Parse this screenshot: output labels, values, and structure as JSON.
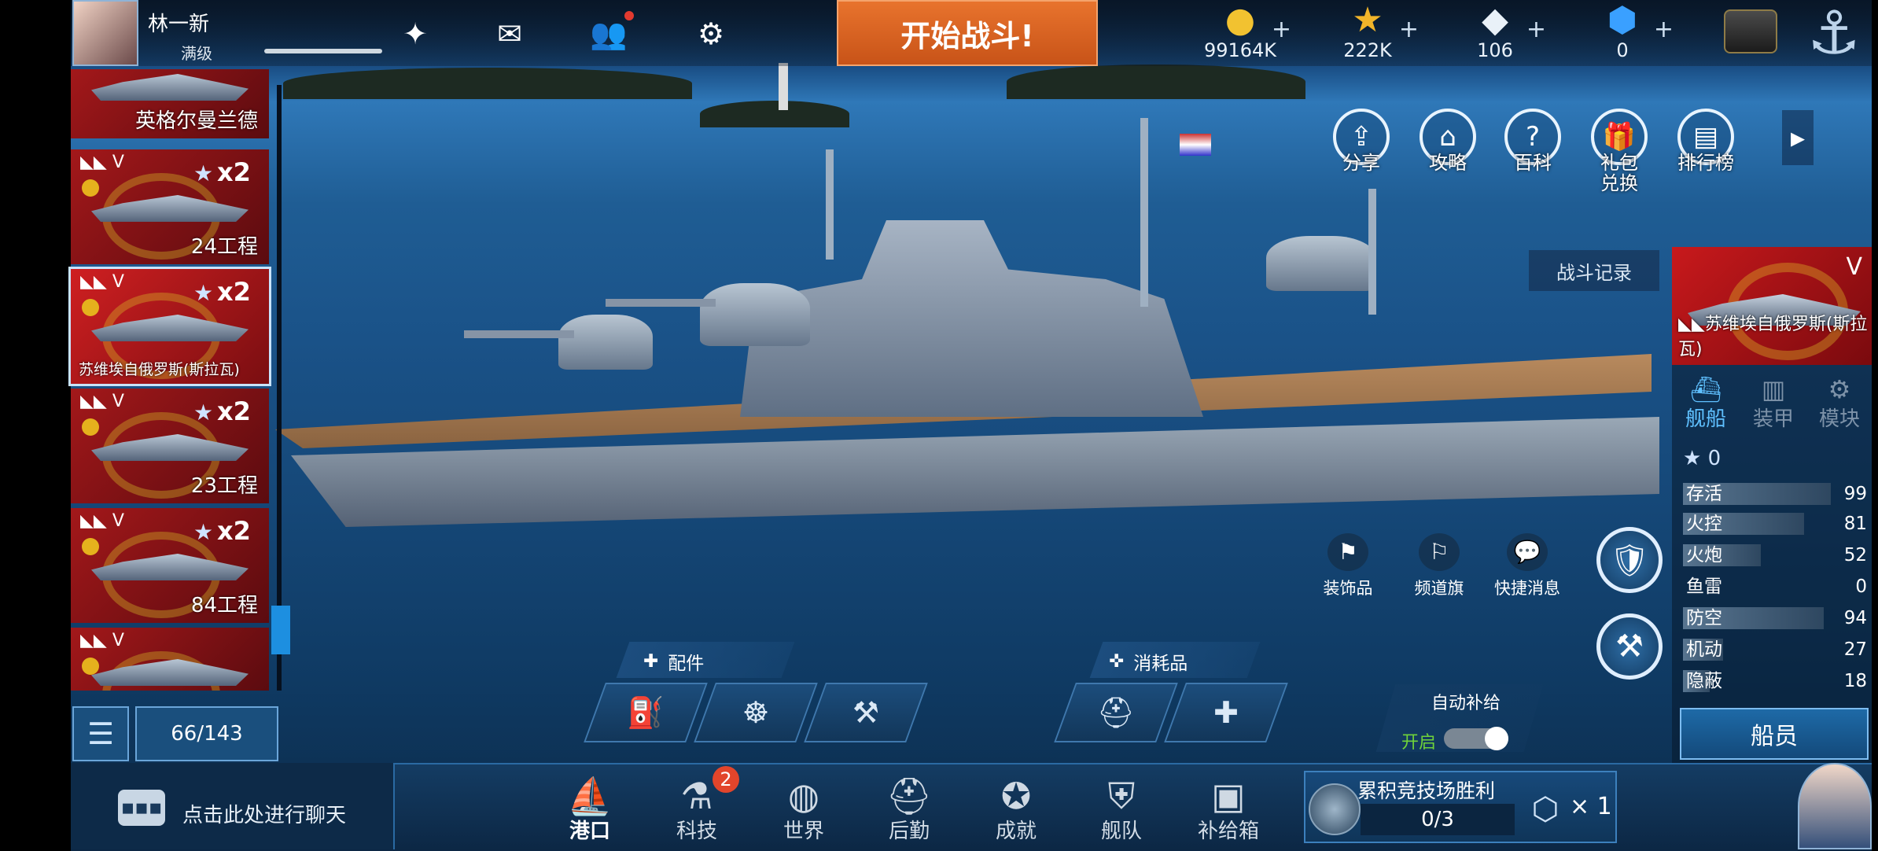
{
  "player": {
    "name": "林一新",
    "level": "满级"
  },
  "top_icons": [
    {
      "name": "wings-icon",
      "glyph": "✦"
    },
    {
      "name": "mail-icon",
      "glyph": "✉"
    },
    {
      "name": "friends-icon",
      "glyph": "👥"
    },
    {
      "name": "gear-icon",
      "glyph": "⚙"
    }
  ],
  "start_battle": "开始战斗!",
  "resources": [
    {
      "name": "gold",
      "icon": "●",
      "value": "99164K",
      "color": "#f2c230"
    },
    {
      "name": "merit",
      "icon": "★",
      "value": "222K",
      "color": "#f2b52a"
    },
    {
      "name": "diamond",
      "icon": "◆",
      "value": "106",
      "color": "#e9f1f8"
    },
    {
      "name": "cube",
      "icon": "⬢",
      "value": "0",
      "color": "#3aa0ff"
    }
  ],
  "features": [
    {
      "label": "分享",
      "glyph": "⇪"
    },
    {
      "label": "攻略",
      "glyph": "⌂"
    },
    {
      "label": "百科",
      "glyph": "?"
    },
    {
      "label": "礼包兑换",
      "glyph": "🎁"
    },
    {
      "label": "排行榜",
      "glyph": "▤"
    }
  ],
  "battle_record": "战斗记录",
  "ship_list": {
    "items": [
      {
        "tier": "",
        "mult": "",
        "name": "英格尔曼兰德",
        "selected": false
      },
      {
        "tier": "V",
        "mult": "x2",
        "name": "24工程",
        "selected": false
      },
      {
        "tier": "V",
        "mult": "x2",
        "name": "苏维埃自俄罗斯(斯拉瓦)",
        "selected": true
      },
      {
        "tier": "V",
        "mult": "x2",
        "name": "23工程",
        "selected": false
      },
      {
        "tier": "V",
        "mult": "x2",
        "name": "84工程",
        "selected": false
      },
      {
        "tier": "V",
        "mult": "",
        "name": "",
        "selected": false
      }
    ],
    "count": "66/143"
  },
  "ship_panel": {
    "tier": "V",
    "name": "苏维埃自俄罗斯(斯拉瓦)",
    "tabs": [
      "舰船",
      "装甲",
      "模块"
    ],
    "stars": "0",
    "stats": [
      {
        "label": "存活",
        "value": "99",
        "fill": 0.99
      },
      {
        "label": "火控",
        "value": "81",
        "fill": 0.81
      },
      {
        "label": "火炮",
        "value": "52",
        "fill": 0.52
      },
      {
        "label": "鱼雷",
        "value": "0",
        "fill": 0.0
      },
      {
        "label": "防空",
        "value": "94",
        "fill": 0.94
      },
      {
        "label": "机动",
        "value": "27",
        "fill": 0.27
      },
      {
        "label": "隐蔽",
        "value": "18",
        "fill": 0.18
      }
    ],
    "crew_button": "船员"
  },
  "small_features": [
    {
      "label": "装饰品",
      "glyph": "⚑"
    },
    {
      "label": "频道旗",
      "glyph": "⚐"
    },
    {
      "label": "快捷消息",
      "glyph": "💬"
    }
  ],
  "fittings": {
    "title": "配件",
    "glyph": "✚"
  },
  "consumables": {
    "title": "消耗品",
    "glyph": "✜"
  },
  "auto_supply": {
    "label": "自动补给",
    "state": "开启"
  },
  "chat": {
    "text": "点击此处进行聊天"
  },
  "nav": [
    {
      "label": "港口",
      "glyph": "⛵",
      "active": true,
      "badge": ""
    },
    {
      "label": "科技",
      "glyph": "⚗",
      "active": false,
      "badge": "2"
    },
    {
      "label": "世界",
      "glyph": "◍",
      "active": false,
      "badge": ""
    },
    {
      "label": "后勤",
      "glyph": "⛑",
      "active": false,
      "badge": ""
    },
    {
      "label": "成就",
      "glyph": "✪",
      "active": false,
      "badge": ""
    },
    {
      "label": "舰队",
      "glyph": "⛨",
      "active": false,
      "badge": ""
    },
    {
      "label": "补给箱",
      "glyph": "▣",
      "active": false,
      "badge": ""
    }
  ],
  "arena": {
    "title": "累积竞技场胜利",
    "progress": "0/3",
    "multiplier": "× 1"
  }
}
